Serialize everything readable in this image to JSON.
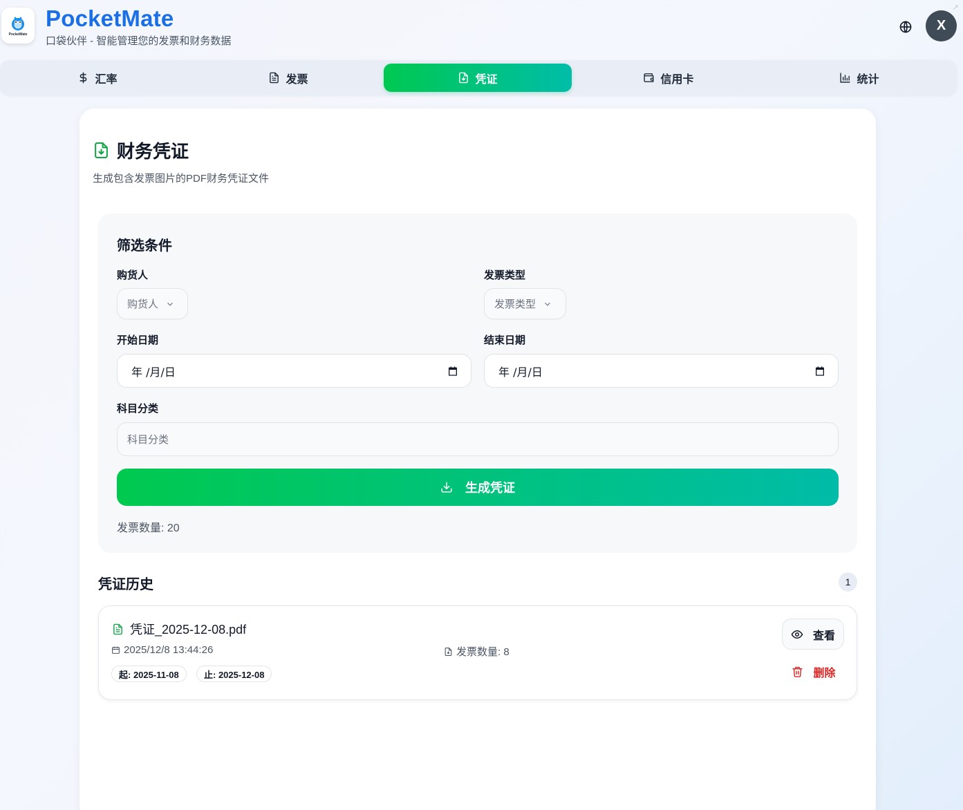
{
  "app": {
    "title": "PocketMate",
    "subtitle": "口袋伙伴 - 智能管理您的发票和财务数据",
    "logo_text": "PocketMate",
    "avatar_initial": "X"
  },
  "tabs": [
    {
      "label": "汇率",
      "icon": "dollar-icon",
      "active": false
    },
    {
      "label": "发票",
      "icon": "document-icon",
      "active": false
    },
    {
      "label": "凭证",
      "icon": "file-download-icon",
      "active": true
    },
    {
      "label": "信用卡",
      "icon": "wallet-icon",
      "active": false
    },
    {
      "label": "统计",
      "icon": "bar-chart-icon",
      "active": false
    }
  ],
  "page": {
    "title": "财务凭证",
    "subtitle": "生成包含发票图片的PDF财务凭证文件"
  },
  "filters": {
    "title": "筛选条件",
    "buyer": {
      "label": "购货人",
      "placeholder": "购货人"
    },
    "invoice_type": {
      "label": "发票类型",
      "placeholder": "发票类型"
    },
    "start_date": {
      "label": "开始日期",
      "value": "年 /月/日"
    },
    "end_date": {
      "label": "结束日期",
      "value": "年 /月/日"
    },
    "category": {
      "label": "科目分类",
      "placeholder": "科目分类"
    },
    "generate_label": "生成凭证",
    "invoice_count": "发票数量: 20"
  },
  "history": {
    "title": "凭证历史",
    "count": "1",
    "items": [
      {
        "filename": "凭证_2025-12-08.pdf",
        "created": "2025/12/8 13:44:26",
        "invoice_count": "发票数量: 8",
        "start": "起: 2025-11-08",
        "end": "止: 2025-12-08",
        "view_label": "查看",
        "delete_label": "删除"
      }
    ]
  },
  "colors": {
    "brand": "#1a6ee6",
    "accent_start": "#00c94f",
    "accent_end": "#00bca8",
    "danger": "#dc2626",
    "avatar_bg": "#3f4b56"
  }
}
